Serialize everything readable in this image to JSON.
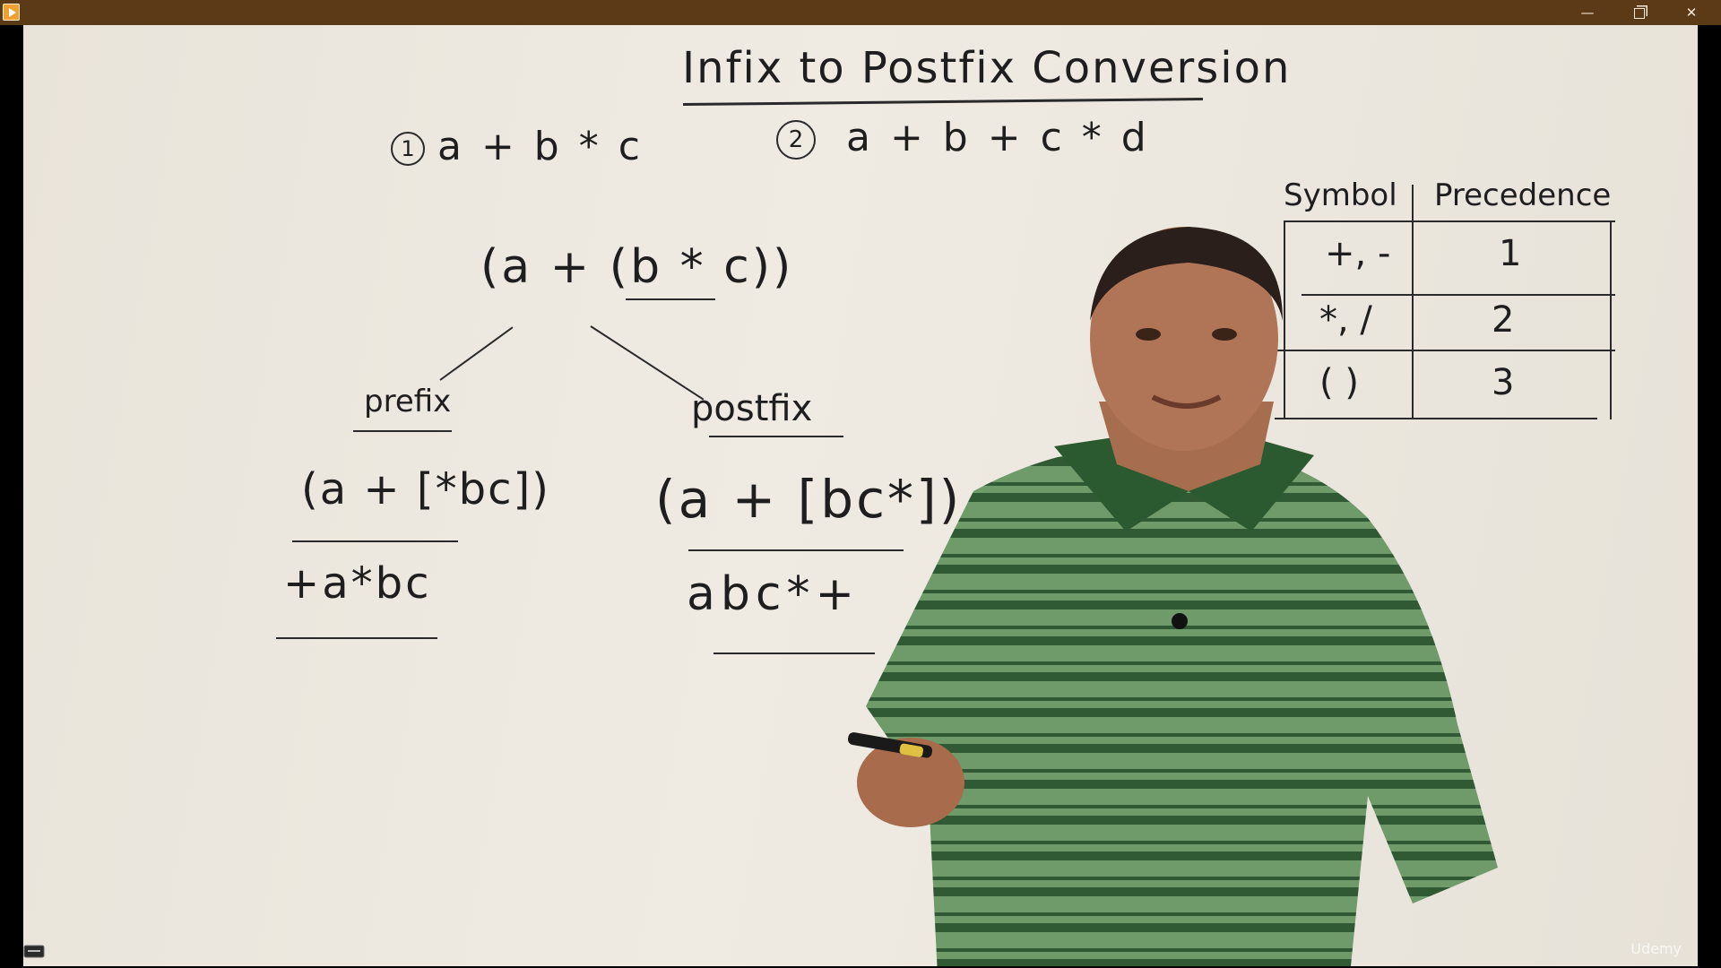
{
  "window": {
    "minimize_glyph": "—",
    "close_glyph": "✕",
    "icons": [
      "app-play-icon",
      "minimize-icon",
      "restore-icon",
      "close-icon"
    ]
  },
  "board": {
    "title": "Infix to Postfix Conversion",
    "example_1_number": "1",
    "example_1": "a + b * c",
    "example_2_number": "2",
    "example_2": "a + b + c * d",
    "main_expression": "(a + (b * c))",
    "prefix_label": "prefix",
    "postfix_label": "postfix",
    "prefix_step": "(a + [*bc])",
    "postfix_step": "(a + [bc*])",
    "prefix_result": "+a*bc",
    "postfix_result": "abc*+"
  },
  "precedence_table": {
    "headers": [
      "Symbol",
      "Precedence"
    ],
    "rows": [
      {
        "symbol": "+, -",
        "precedence": "1"
      },
      {
        "symbol": "*, /",
        "precedence": "2"
      },
      {
        "symbol": "( )",
        "precedence": "3"
      }
    ]
  },
  "watermark": "Udemy",
  "colors": {
    "titlebar": "#5c3a17",
    "board": "#ece8e0",
    "ink": "#1e1e1e",
    "shirt": "#5f8a5a"
  }
}
